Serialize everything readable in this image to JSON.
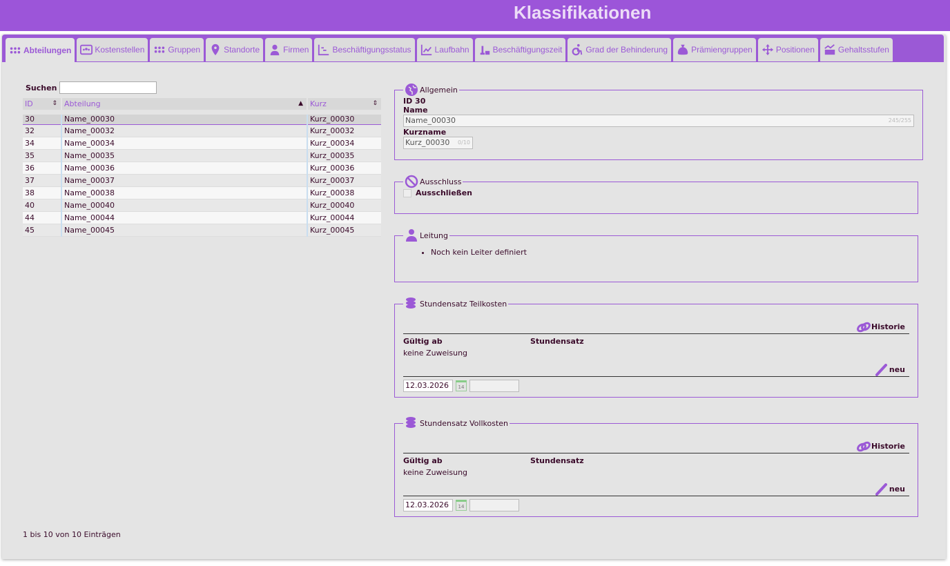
{
  "header": {
    "title": "Klassifikationen"
  },
  "tabs": [
    {
      "label": "Abteilungen",
      "icon": "dots-grid-icon",
      "active": true
    },
    {
      "label": "Kostenstellen",
      "icon": "group-card-icon"
    },
    {
      "label": "Gruppen",
      "icon": "dots-grid-icon"
    },
    {
      "label": "Standorte",
      "icon": "map-pin-icon"
    },
    {
      "label": "Firmen",
      "icon": "person-icon"
    },
    {
      "label": "Beschäftigungsstatus",
      "icon": "status-chart-icon"
    },
    {
      "label": "Laufbahn",
      "icon": "line-chart-icon"
    },
    {
      "label": "Beschäftigungszeit",
      "icon": "chess-icon"
    },
    {
      "label": "Grad der Behinderung",
      "icon": "wheelchair-icon"
    },
    {
      "label": "Prämiengruppen",
      "icon": "money-bag-icon"
    },
    {
      "label": "Positionen",
      "icon": "move-arrows-icon"
    },
    {
      "label": "Gehaltsstufen",
      "icon": "salary-trend-icon"
    }
  ],
  "list": {
    "search_label": "Suchen",
    "search_value": "",
    "columns": [
      "ID",
      "Abteilung",
      "Kurz"
    ],
    "rows": [
      [
        "30",
        "Name_00030",
        "Kurz_00030"
      ],
      [
        "32",
        "Name_00032",
        "Kurz_00032"
      ],
      [
        "34",
        "Name_00034",
        "Kurz_00034"
      ],
      [
        "35",
        "Name_00035",
        "Kurz_00035"
      ],
      [
        "36",
        "Name_00036",
        "Kurz_00036"
      ],
      [
        "37",
        "Name_00037",
        "Kurz_00037"
      ],
      [
        "38",
        "Name_00038",
        "Kurz_00038"
      ],
      [
        "40",
        "Name_00040",
        "Kurz_00040"
      ],
      [
        "44",
        "Name_00044",
        "Kurz_00044"
      ],
      [
        "45",
        "Name_00045",
        "Kurz_00045"
      ]
    ],
    "info": "1 bis 10 von 10 Einträgen"
  },
  "allgemein": {
    "legend": "Allgemein",
    "id_text": "ID 30",
    "name_label": "Name",
    "name_value": "Name_00030",
    "name_count": "245/255",
    "kurz_label": "Kurzname",
    "kurz_value": "Kurz_00030",
    "kurz_count": "0/10"
  },
  "ausschluss": {
    "legend": "Ausschluss",
    "checkbox_label": "Ausschließen",
    "checked": false
  },
  "leitung": {
    "legend": "Leitung",
    "item": "Noch kein Leiter definiert"
  },
  "teilkosten": {
    "legend": "Stundensatz Teilkosten",
    "historie": "Historie",
    "col1": "Gültig ab",
    "col2": "Stundensatz",
    "empty": "keine Zuweisung",
    "neu": "neu",
    "date": "12.03.2026",
    "cal": "14",
    "rate": ""
  },
  "vollkosten": {
    "legend": "Stundensatz Vollkosten",
    "historie": "Historie",
    "col1": "Gültig ab",
    "col2": "Stundensatz",
    "empty": "keine Zuweisung",
    "neu": "neu",
    "date": "12.03.2026",
    "cal": "14",
    "rate": ""
  },
  "colors": {
    "accent": "#9b59d6",
    "header": "#9c55d9",
    "bg": "#e4e4e4"
  }
}
